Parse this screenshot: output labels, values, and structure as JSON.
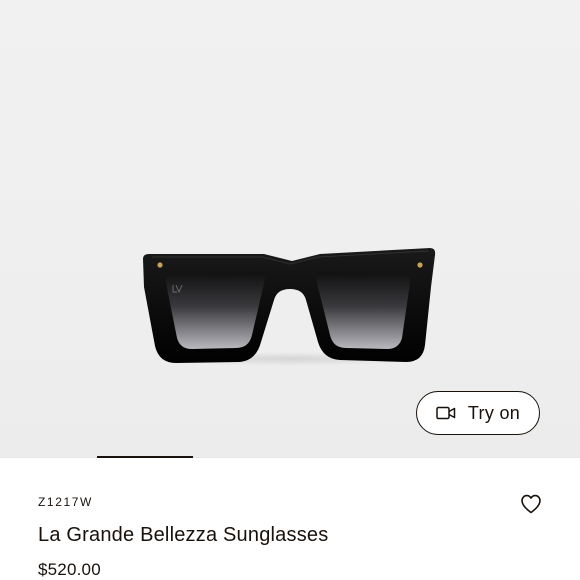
{
  "product": {
    "sku": "Z1217W",
    "name": "La Grande Bellezza Sunglasses",
    "price": "$520.00",
    "image_alt": "La Grande Bellezza Sunglasses",
    "image_icon": "sunglasses-product-image"
  },
  "try_on": {
    "label": "Try on",
    "icon": "video-camera-icon"
  },
  "wishlist": {
    "icon": "heart-outline-icon"
  },
  "carousel": {
    "active_index": 1
  },
  "colors": {
    "text": "#19110b",
    "hero_background": "#efefef",
    "frame": "#050505"
  }
}
